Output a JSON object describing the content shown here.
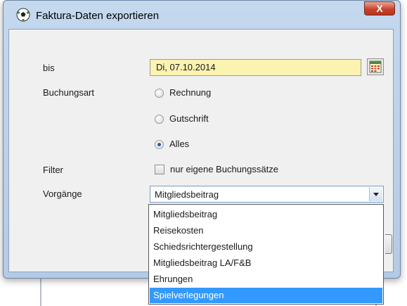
{
  "window": {
    "title": "Faktura-Daten exportieren",
    "close_label": "X"
  },
  "form": {
    "bis_label": "bis",
    "bis_value": "Di, 07.10.2014",
    "buchungsart_label": "Buchungsart",
    "buchungsart_options": [
      {
        "label": "Rechnung",
        "checked": false
      },
      {
        "label": "Gutschrift",
        "checked": false
      },
      {
        "label": "Alles",
        "checked": true
      }
    ],
    "filter_label": "Filter",
    "filter_checkbox_label": "nur eigene Buchungssätze",
    "filter_checked": false,
    "vorgaenge_label": "Vorgänge",
    "vorgaenge_value": "Mitgliedsbeitrag"
  },
  "dropdown": {
    "items": [
      "Mitgliedsbeitrag",
      "Reisekosten",
      "Schiedsrichtergestellung",
      "Mitgliedsbeitrag LA/F&B",
      "Ehrungen",
      "Spielverlegungen"
    ],
    "highlighted": "Spielverlegungen"
  },
  "colors": {
    "date_field_bg": "#fbf3b0",
    "highlight": "#3399ff",
    "close_button": "#c7432d"
  }
}
